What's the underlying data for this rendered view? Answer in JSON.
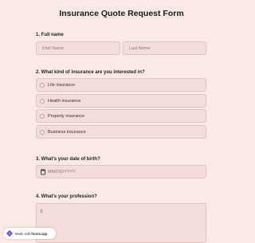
{
  "form": {
    "title": "Insurance Quote Request Form",
    "q1": {
      "label": "1.  Full name",
      "first_placeholder": "First Name",
      "last_placeholder": "Last Name"
    },
    "q2": {
      "label": "2.  What kind of insurance are you interested in?",
      "options": [
        "Life insurance",
        "Health insurance",
        "Property insurance",
        "Business insurance"
      ]
    },
    "q3": {
      "label": "3.  What's your date of birth?",
      "placeholder": "MM/DD/YYYY",
      "icon": "calendar-icon"
    },
    "q4": {
      "label": "4.  What's your profession?",
      "cursor": "I:"
    }
  },
  "badge": {
    "prefix": "Made with",
    "brand": "forms.app",
    "icon": "formsapp-logo-icon"
  }
}
